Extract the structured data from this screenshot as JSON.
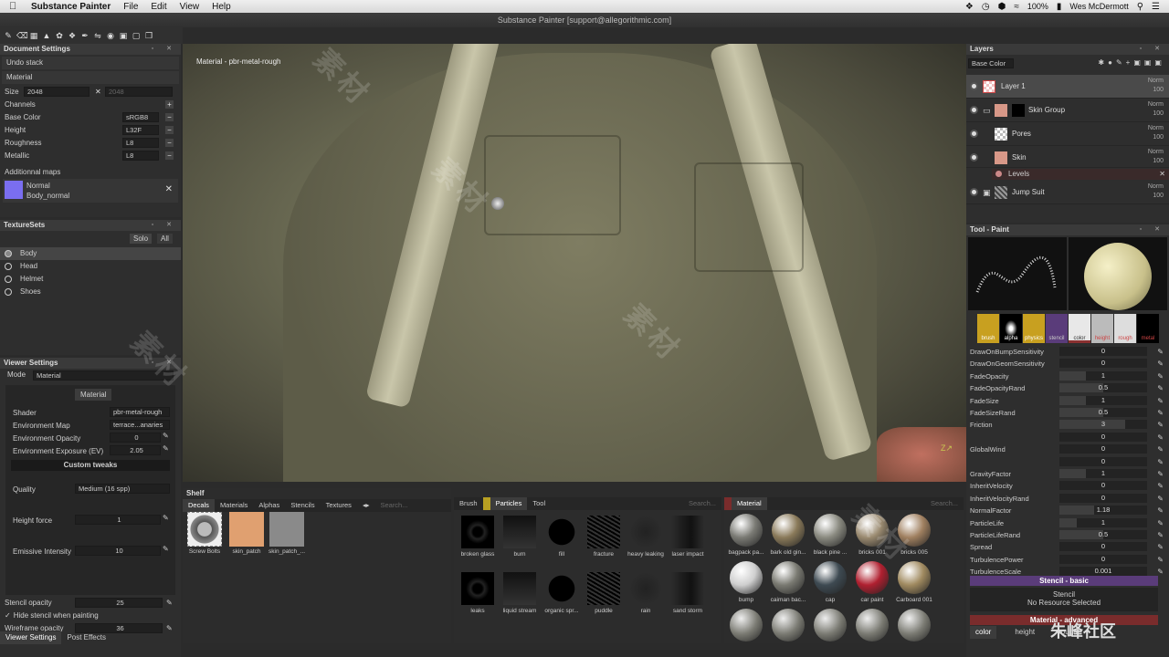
{
  "menubar": {
    "app_name": "Substance Painter",
    "menus": [
      "File",
      "Edit",
      "View",
      "Help"
    ],
    "battery": "100%",
    "user": "Wes McDermott"
  },
  "window": {
    "title": "Substance Painter [support@allegorithmic.com]"
  },
  "document_settings": {
    "title": "Document Settings",
    "undo_stack": "Undo stack",
    "material": "Material",
    "size_label": "Size",
    "size_value": "2048",
    "size_value2": "2048",
    "channels_label": "Channels",
    "channels": [
      {
        "name": "Base Color",
        "format": "sRGB8"
      },
      {
        "name": "Height",
        "format": "L32F"
      },
      {
        "name": "Roughness",
        "format": "L8"
      },
      {
        "name": "Metallic",
        "format": "L8"
      }
    ],
    "additional_maps": "Additionnal maps",
    "map_type": "Normal",
    "map_name": "Body_normal"
  },
  "texture_sets": {
    "title": "TextureSets",
    "solo": "Solo",
    "all": "All",
    "items": [
      "Body",
      "Head",
      "Helmet",
      "Shoes"
    ]
  },
  "viewer_settings": {
    "title": "Viewer Settings",
    "mode_label": "Mode",
    "mode_value": "Material",
    "material_button": "Material",
    "shader_label": "Shader",
    "shader_value": "pbr-metal-rough",
    "env_map_label": "Environment Map",
    "env_map_value": "terrace...anaries",
    "env_opacity_label": "Environment Opacity",
    "env_opacity_value": "0",
    "env_exposure_label": "Environment Exposure (EV)",
    "env_exposure_value": "2.05",
    "custom_tweaks": "Custom tweaks",
    "quality_label": "Quality",
    "quality_value": "Medium (16 spp)",
    "height_force_label": "Height force",
    "height_force_value": "1",
    "emissive_label": "Emissive Intensity",
    "emissive_value": "10",
    "stencil_opacity_label": "Stencil opacity",
    "stencil_opacity_value": "25",
    "hide_stencil_label": "Hide stencil when painting",
    "wireframe_label": "Wireframe opacity",
    "wireframe_value": "36",
    "bottom_tabs": [
      "Viewer Settings",
      "Post Effects"
    ]
  },
  "viewport": {
    "label": "Material - pbr-metal-rough"
  },
  "layers": {
    "title": "Layers",
    "channel": "Base Color",
    "items": [
      {
        "name": "Layer 1",
        "blend": "Norm",
        "opacity": "100"
      },
      {
        "name": "Skin Group",
        "blend": "Norm",
        "opacity": "100"
      },
      {
        "name": "Pores",
        "blend": "Norm",
        "opacity": "100"
      },
      {
        "name": "Skin",
        "blend": "Norm",
        "opacity": "100"
      },
      {
        "name": "Jump Suit",
        "blend": "Norm",
        "opacity": "100"
      }
    ],
    "levels": "Levels"
  },
  "tool_paint": {
    "title": "Tool - Paint",
    "slots": [
      "brush",
      "alpha",
      "physics",
      "stencil",
      "color",
      "height",
      "rough",
      "metal"
    ],
    "properties": [
      {
        "name": "DrawOnBumpSensitivity",
        "value": "0",
        "fill": 0
      },
      {
        "name": "DrawOnGeomSensitivity",
        "value": "0",
        "fill": 0
      },
      {
        "name": "FadeOpacity",
        "value": "1",
        "fill": 0.3
      },
      {
        "name": "FadeOpacityRand",
        "value": "0.5",
        "fill": 0.5
      },
      {
        "name": "FadeSize",
        "value": "1",
        "fill": 0.3
      },
      {
        "name": "FadeSizeRand",
        "value": "0.5",
        "fill": 0.5
      },
      {
        "name": "Friction",
        "value": "3",
        "fill": 0.75
      },
      {
        "name": "",
        "value": "0",
        "fill": 0
      },
      {
        "name": "GlobalWind",
        "value": "0",
        "fill": 0
      },
      {
        "name": "",
        "value": "0",
        "fill": 0
      },
      {
        "name": "GravityFactor",
        "value": "1",
        "fill": 0.3
      },
      {
        "name": "InheritVelocity",
        "value": "0",
        "fill": 0
      },
      {
        "name": "InheritVelocityRand",
        "value": "0",
        "fill": 0
      },
      {
        "name": "NormalFactor",
        "value": "1.18",
        "fill": 0.4
      },
      {
        "name": "ParticleLife",
        "value": "1",
        "fill": 0.2
      },
      {
        "name": "ParticleLifeRand",
        "value": "0.5",
        "fill": 0.5
      },
      {
        "name": "Spread",
        "value": "0",
        "fill": 0
      },
      {
        "name": "TurbulencePower",
        "value": "0",
        "fill": 0
      },
      {
        "name": "TurbulenceScale",
        "value": "0.001",
        "fill": 0
      }
    ],
    "stencil_basic": "Stencil - basic",
    "stencil_label": "Stencil",
    "stencil_none": "No Resource Selected",
    "material_advanced": "Material - advanced",
    "bottom_tabs": [
      "color",
      "height",
      "rough"
    ]
  },
  "shelf": {
    "title": "Shelf",
    "tabs": [
      "Decals",
      "Materials",
      "Alphas",
      "Stencils",
      "Textures"
    ],
    "search_placeholder": "Search...",
    "decals": [
      "Screw Bolts",
      "skin_patch",
      "skin_patch_..."
    ],
    "brush_tabs": [
      "Brush",
      "Particles",
      "Tool"
    ],
    "particles": [
      "broken glass",
      "burn",
      "fill",
      "fracture",
      "heavy leaking",
      "laser impact",
      "leaks",
      "liquid stream",
      "organic spr...",
      "puddle",
      "rain",
      "sand storm"
    ],
    "material_tab": "Material",
    "materials": [
      "bagpack pa...",
      "bark old gin...",
      "black pine ...",
      "bricks 001",
      "bricks 005",
      "bump",
      "caiman bac...",
      "cap",
      "car paint",
      "Carboard 001"
    ]
  },
  "colors": {
    "accent_purple": "#5a3c7a",
    "accent_red": "#7a2c2c",
    "bg": "#2e2e2e",
    "particles_yellow": "#b8a022"
  }
}
